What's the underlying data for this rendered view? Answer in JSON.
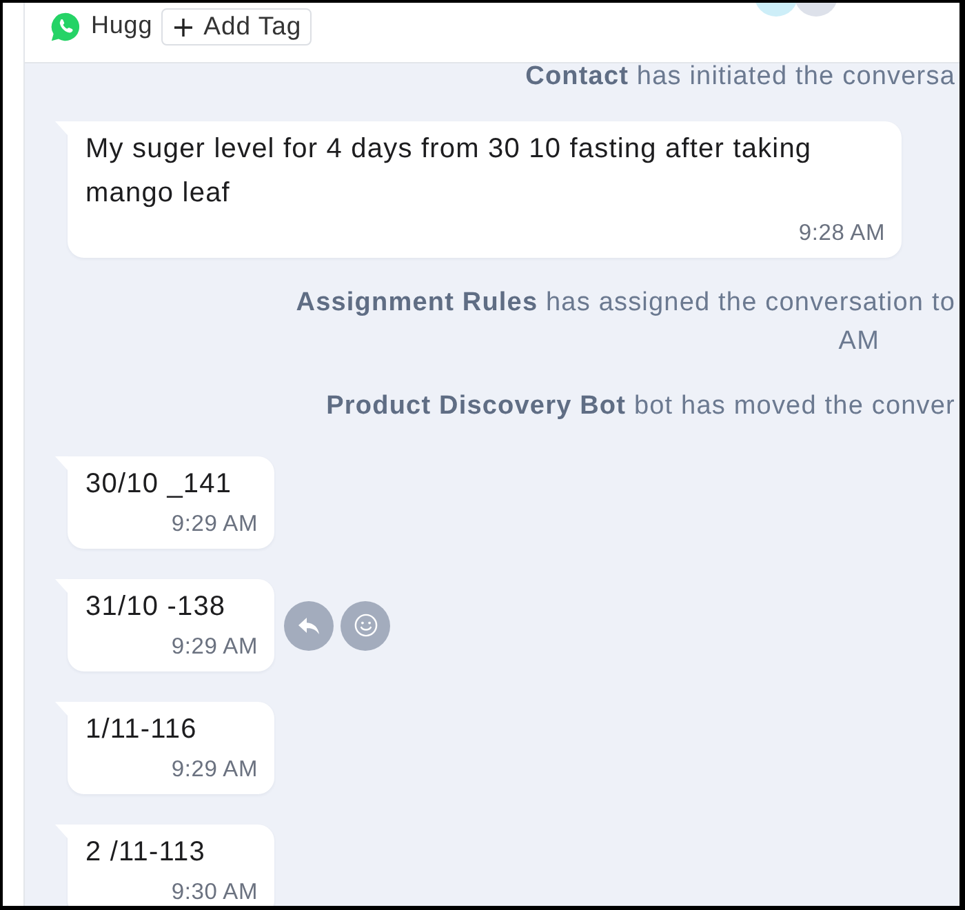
{
  "header": {
    "contact_name": "Hugg",
    "add_tag_label": "Add Tag"
  },
  "events": [
    {
      "kind": "system",
      "text": "**Contact** has initiated the conversa"
    },
    {
      "kind": "message",
      "text": "My suger level for 4 days from 30 10 fasting after taking mango leaf",
      "time": "9:28 AM",
      "show_actions": false
    },
    {
      "kind": "system",
      "text": "**Assignment Rules** has assigned the conversation to",
      "continuation": "AM"
    },
    {
      "kind": "system",
      "text": "**Product Discovery Bot** bot has moved the conver"
    },
    {
      "kind": "message",
      "text": "30/10 _141",
      "time": "9:29 AM",
      "show_actions": false
    },
    {
      "kind": "message",
      "text": "31/10 -138",
      "time": "9:29 AM",
      "show_actions": true
    },
    {
      "kind": "message",
      "text": "1/11-116",
      "time": "9:29 AM",
      "show_actions": false
    },
    {
      "kind": "message",
      "text": "2 /11-113",
      "time": "9:30 AM",
      "show_actions": false
    }
  ]
}
